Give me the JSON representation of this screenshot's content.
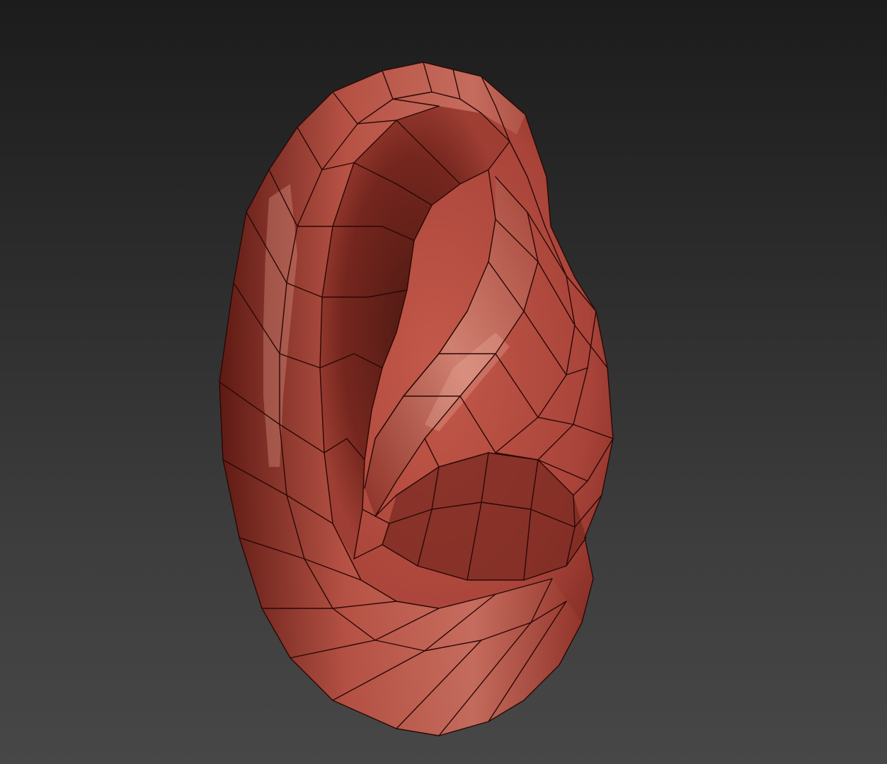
{
  "scene": {
    "object": "ear",
    "render_style": "wireframe-on-shaded",
    "colors": {
      "background_top": "#1c1c1c",
      "background_bottom": "#474747",
      "material_base": "#b04a3c",
      "material_highlight": "#d27a6c",
      "material_shadow": "#4a1410",
      "wire": "#2a0805"
    }
  }
}
